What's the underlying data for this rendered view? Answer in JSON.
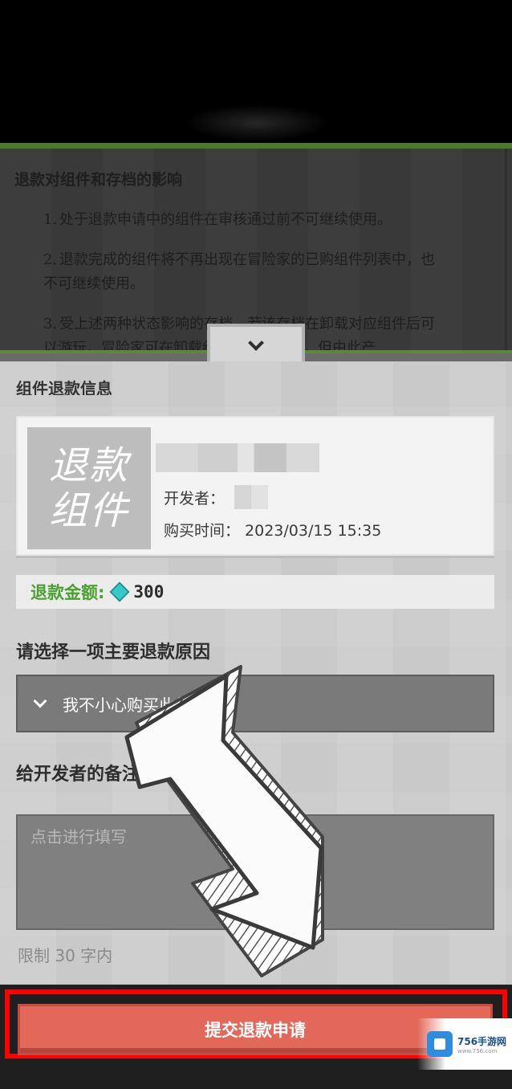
{
  "policy": {
    "title": "退款对组件和存档的影响",
    "items": [
      {
        "num": "1.",
        "line1": "处于退款申请中的组件在审核通过前不可继续使用。",
        "line2": ""
      },
      {
        "num": "2.",
        "line1": "退款完成的组件将不再出现在冒险家的已购组件列表中，也",
        "line2": "不可继续使用。"
      },
      {
        "num": "3.",
        "line1": "受上述两种状态影响的存档，若该存档在卸载对应组件后可",
        "line2": "以游玩，冒险家可在卸载组件后进入存档，但由此产"
      }
    ]
  },
  "section_title": "组件退款信息",
  "item": {
    "thumb_line1": "退款",
    "thumb_line2": "组件",
    "developer_label": "开发者：",
    "purchase_time_label": "购买时间：",
    "purchase_time_value": "2023/03/15 15:35"
  },
  "refund": {
    "amount_label": "退款金额:",
    "amount_value": "300",
    "currency_icon": "diamond-icon"
  },
  "reason": {
    "title": "请选择一项主要退款原因",
    "selected": "我不小心购买此组件"
  },
  "notes": {
    "title": "给开发者的备注",
    "placeholder": "点击进行填写",
    "limit": "限制 30 字内"
  },
  "submit_label": "提交退款申请",
  "watermark": {
    "name": "756手游网",
    "url": "www.756.com"
  },
  "colors": {
    "accent_green": "#4aa132",
    "submit_red": "#e2685a",
    "highlight": "#ff0000"
  }
}
